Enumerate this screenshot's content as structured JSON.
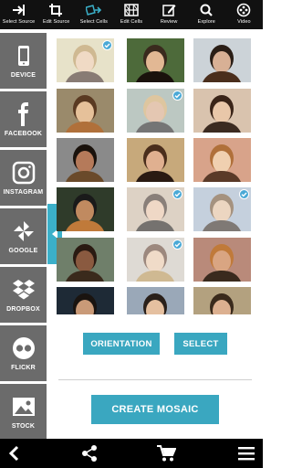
{
  "toolbar": {
    "items": [
      {
        "label": "Select Source",
        "icon": "arrow-right-into-icon"
      },
      {
        "label": "Edit Source",
        "icon": "crop-icon"
      },
      {
        "label": "Select Cells",
        "icon": "select-cells-icon"
      },
      {
        "label": "Edit Cells",
        "icon": "grid-icon"
      },
      {
        "label": "Review",
        "icon": "edit-icon"
      },
      {
        "label": "Explore",
        "icon": "search-icon"
      },
      {
        "label": "Video",
        "icon": "film-reel-icon"
      }
    ],
    "active_index": 2
  },
  "sidebar": {
    "sources": [
      {
        "label": "DEVICE",
        "icon": "phone-icon"
      },
      {
        "label": "FACEBOOK",
        "icon": "facebook-icon"
      },
      {
        "label": "INSTAGRAM",
        "icon": "instagram-icon"
      },
      {
        "label": "GOOGLE",
        "icon": "pinwheel-icon"
      },
      {
        "label": "DROPBOX",
        "icon": "dropbox-icon"
      },
      {
        "label": "FLICKR",
        "icon": "flickr-icon"
      },
      {
        "label": "STOCK",
        "icon": "image-icon"
      }
    ]
  },
  "grid": {
    "photos": [
      {
        "selected": true,
        "dim": true
      },
      {
        "selected": false,
        "dim": false
      },
      {
        "selected": false,
        "dim": false
      },
      {
        "selected": false,
        "dim": false
      },
      {
        "selected": true,
        "dim": true
      },
      {
        "selected": false,
        "dim": false
      },
      {
        "selected": false,
        "dim": false
      },
      {
        "selected": false,
        "dim": false
      },
      {
        "selected": false,
        "dim": false
      },
      {
        "selected": false,
        "dim": false
      },
      {
        "selected": true,
        "dim": true
      },
      {
        "selected": true,
        "dim": true
      },
      {
        "selected": false,
        "dim": false
      },
      {
        "selected": true,
        "dim": true
      },
      {
        "selected": false,
        "dim": false
      },
      {
        "selected": false,
        "dim": false
      },
      {
        "selected": false,
        "dim": false
      },
      {
        "selected": false,
        "dim": false
      }
    ]
  },
  "actions": {
    "orientation": "ORIENTATION",
    "select": "SELECT",
    "create": "CREATE MOSAIC"
  },
  "bottom": {
    "icons": [
      "back-icon",
      "share-icon",
      "cart-icon",
      "menu-icon"
    ]
  },
  "colors": {
    "accent": "#3aa7c0",
    "sidebar_tile": "#6b6b6b",
    "toolbar_bg": "#111111",
    "check": "#4aa9d6"
  }
}
